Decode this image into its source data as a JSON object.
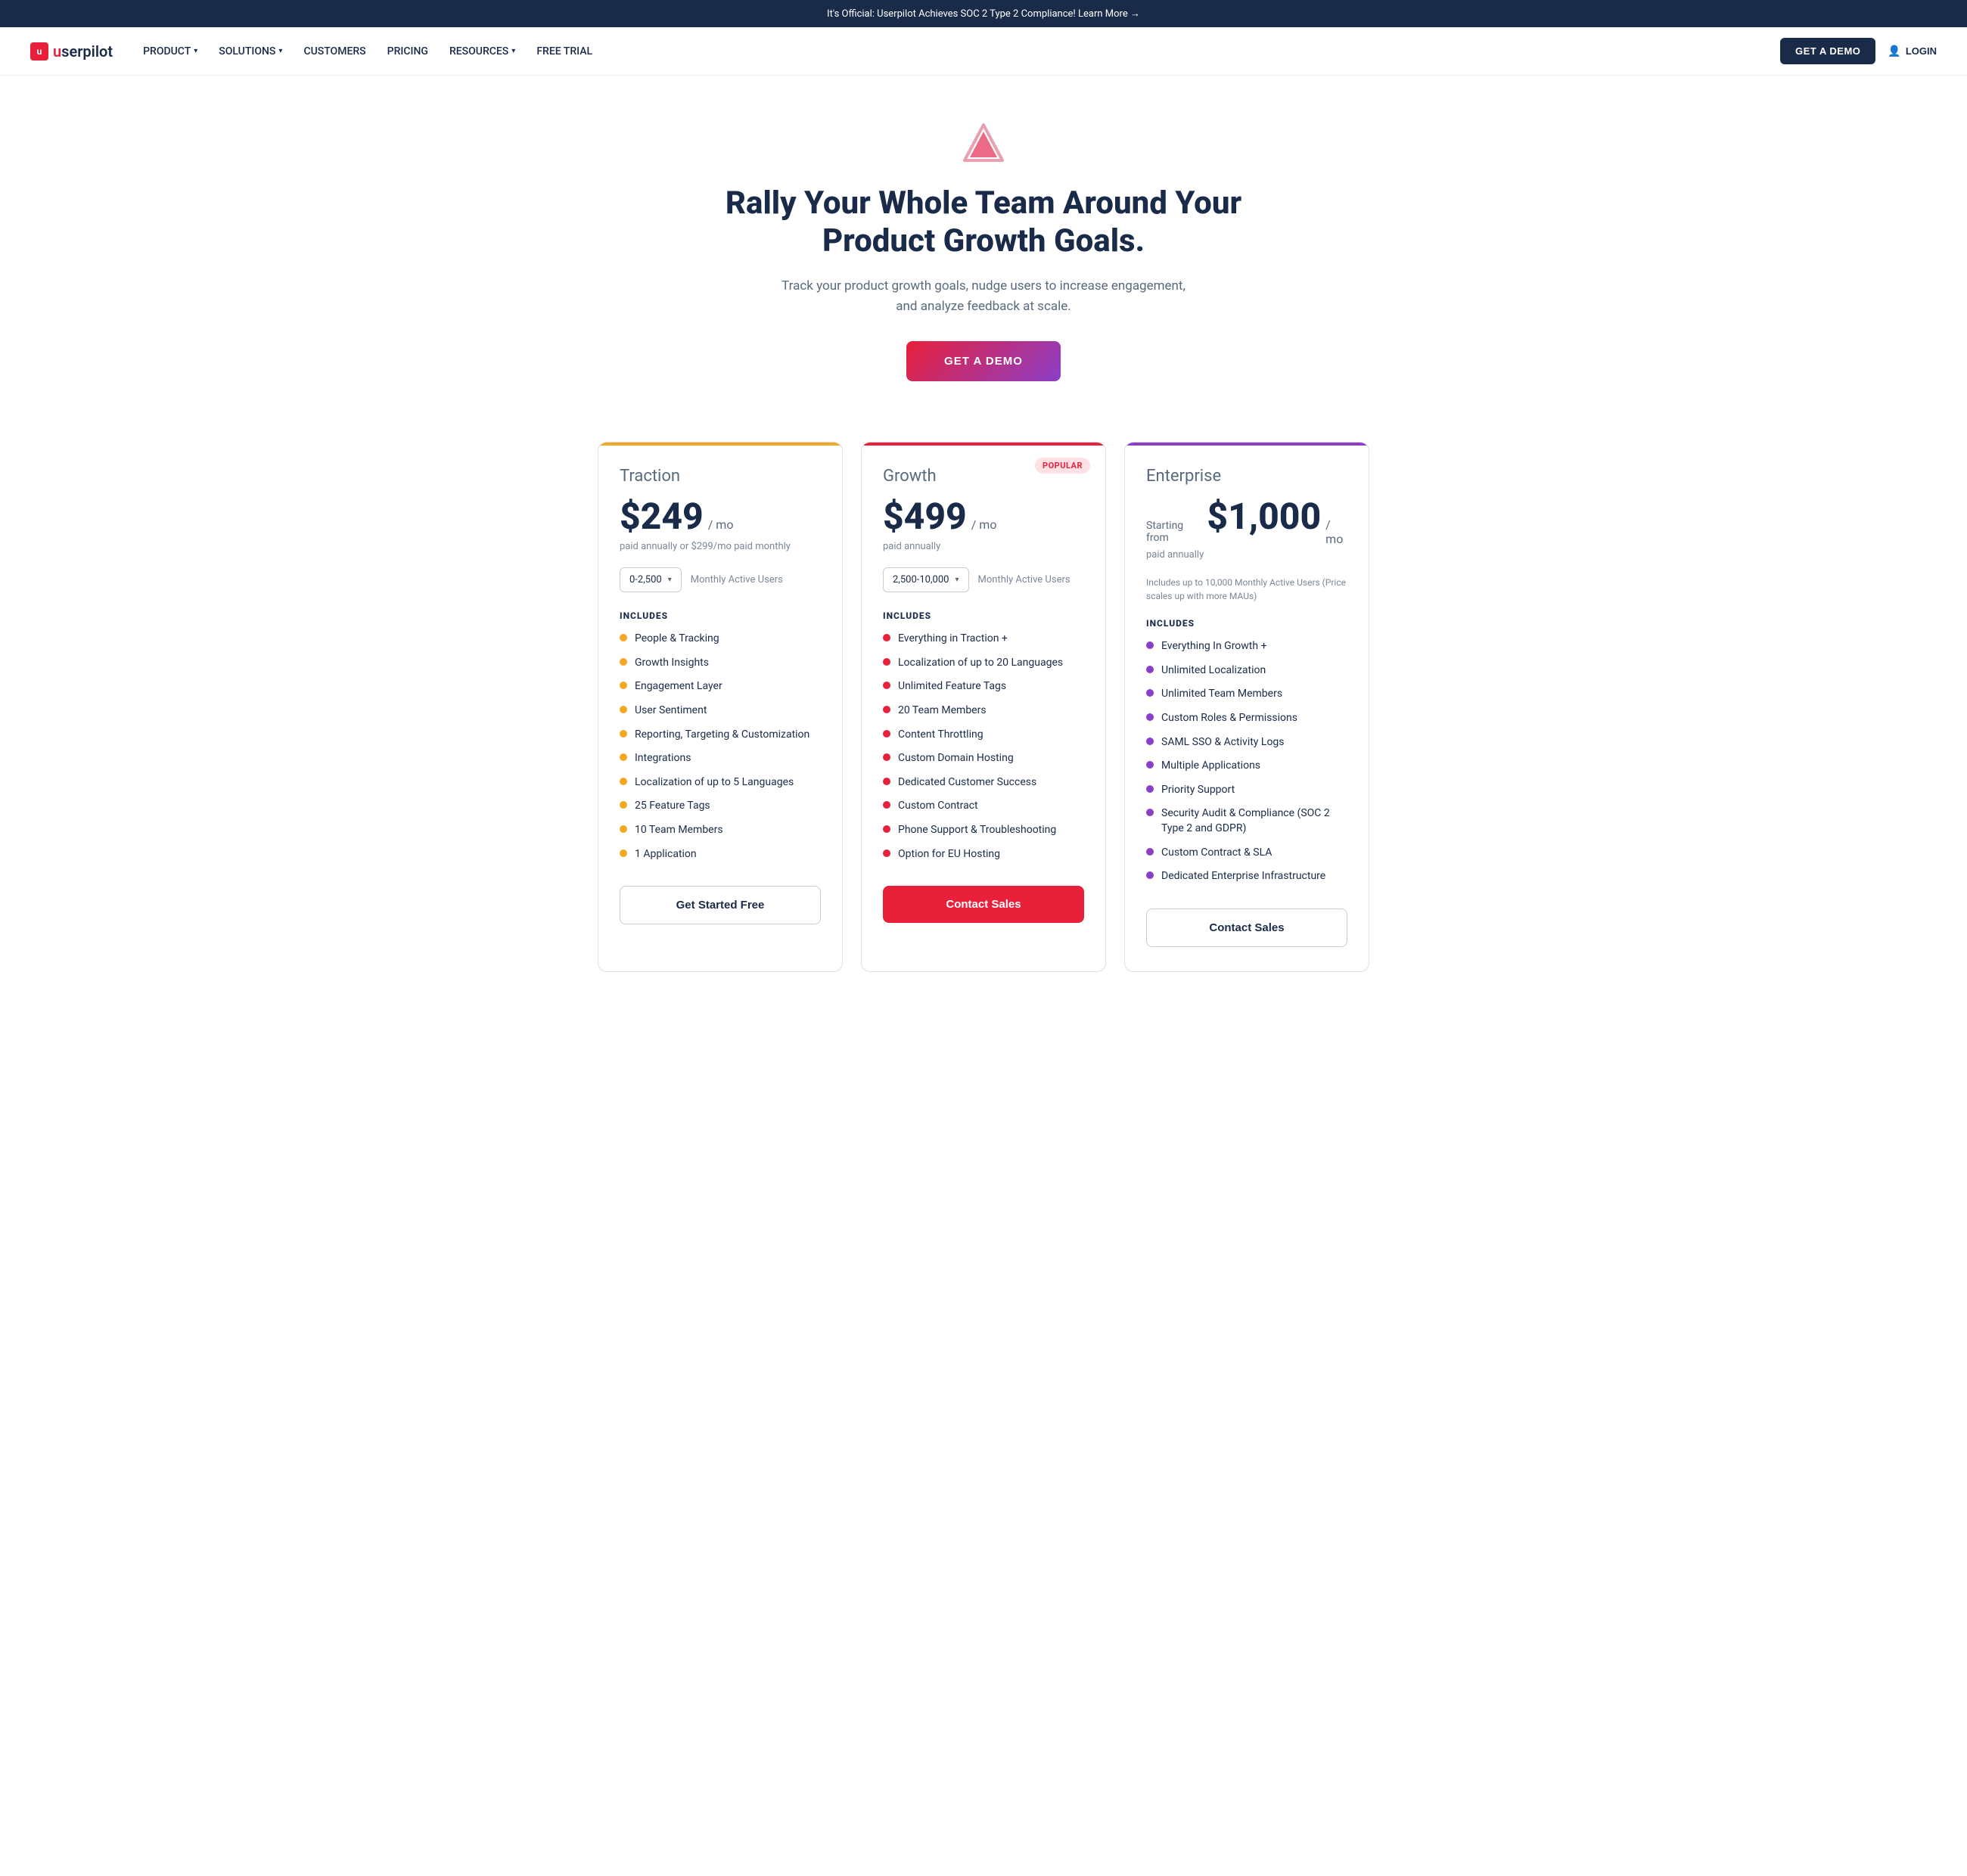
{
  "announcement": {
    "text": "It's Official: Userpilot Achieves SOC 2 Type 2 Compliance! Learn More →"
  },
  "nav": {
    "logo_text": "userpilot",
    "logo_letter": "u",
    "links": [
      {
        "label": "PRODUCT",
        "has_dropdown": true
      },
      {
        "label": "SOLUTIONS",
        "has_dropdown": true
      },
      {
        "label": "CUSTOMERS",
        "has_dropdown": false
      },
      {
        "label": "PRICING",
        "has_dropdown": false
      },
      {
        "label": "RESOURCES",
        "has_dropdown": true
      },
      {
        "label": "FREE TRIAL",
        "has_dropdown": false
      }
    ],
    "btn_demo": "GET A DEMO",
    "btn_login": "LOGIN"
  },
  "hero": {
    "heading_line1": "Rally Your Whole Team Around Your",
    "heading_line2": "Product Growth Goals.",
    "subtext": "Track your product growth goals, nudge users to increase engagement, and analyze feedback at scale.",
    "cta_label": "GET A DEMO"
  },
  "plans": [
    {
      "id": "traction",
      "name": "Traction",
      "price": "$249",
      "period": "/ mo",
      "starting_from": "",
      "note": "paid annually or $299/mo paid monthly",
      "popular": false,
      "mau_default": "0-2,500",
      "mau_label": "Monthly Active Users",
      "includes_label": "INCLUDES",
      "enterprise_note": "",
      "features": [
        "People & Tracking",
        "Growth Insights",
        "Engagement Layer",
        "User Sentiment",
        "Reporting, Targeting & Customization",
        "Integrations",
        "Localization of up to 5 Languages",
        "25 Feature Tags",
        "10 Team Members",
        "1 Application"
      ],
      "dot_class": "dot-orange",
      "cta_label": "Get Started Free",
      "cta_style": "outline"
    },
    {
      "id": "growth",
      "name": "Growth",
      "price": "$499",
      "period": "/ mo",
      "starting_from": "",
      "note": "paid annually",
      "popular": true,
      "popular_label": "POPULAR",
      "mau_default": "2,500-10,000",
      "mau_label": "Monthly Active Users",
      "includes_label": "INCLUDES",
      "enterprise_note": "",
      "features": [
        "Everything in Traction +",
        "Localization of up to 20 Languages",
        "Unlimited Feature Tags",
        "20 Team Members",
        "Content Throttling",
        "Custom Domain Hosting",
        "Dedicated Customer Success",
        "Custom Contract",
        "Phone Support & Troubleshooting",
        "Option for EU Hosting"
      ],
      "dot_class": "dot-pink",
      "cta_label": "Contact Sales",
      "cta_style": "pink"
    },
    {
      "id": "enterprise",
      "name": "Enterprise",
      "price": "$1,000",
      "period": "/ mo",
      "starting_from": "Starting from",
      "note": "paid annually",
      "popular": false,
      "mau_default": "",
      "mau_label": "",
      "includes_label": "INCLUDES",
      "enterprise_note": "Includes up to 10,000 Monthly Active Users (Price scales up with more MAUs)",
      "features": [
        "Everything In Growth +",
        "Unlimited Localization",
        "Unlimited Team Members",
        "Custom Roles & Permissions",
        "SAML SSO & Activity Logs",
        "Multiple Applications",
        "Priority Support",
        "Security Audit & Compliance (SOC 2 Type 2 and GDPR)",
        "Custom Contract & SLA",
        "Dedicated Enterprise Infrastructure"
      ],
      "dot_class": "dot-purple",
      "cta_label": "Contact Sales",
      "cta_style": "outline"
    }
  ]
}
